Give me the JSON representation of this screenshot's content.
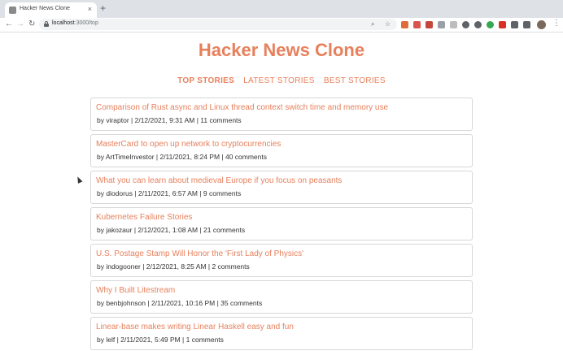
{
  "browser": {
    "tab_title": "Hacker News Clone",
    "tab_close": "×",
    "new_tab": "+",
    "url_host": "localhost",
    "url_path": ":3000/top",
    "back": "←",
    "forward": "→",
    "reload": "↻",
    "menu": "⋮"
  },
  "site": {
    "title": "Hacker News Clone"
  },
  "nav": {
    "items": [
      "TOP STORIES",
      "LATEST STORIES",
      "BEST STORIES"
    ],
    "active": "TOP STORIES"
  },
  "stories": [
    {
      "title": "Comparison of Rust async and Linux thread context switch time and memory use",
      "meta": "by viraptor | 2/12/2021, 9:31 AM | 11 comments"
    },
    {
      "title": "MasterCard to open up network to cryptocurrencies",
      "meta": "by ArtTimeInvestor | 2/11/2021, 8:24 PM | 40 comments"
    },
    {
      "title": "What you can learn about medieval Europe if you focus on peasants",
      "meta": "by diodorus | 2/11/2021, 6:57 AM | 9 comments"
    },
    {
      "title": "Kubernetes Failure Stories",
      "meta": "by jakozaur | 2/12/2021, 1:08 AM | 21 comments"
    },
    {
      "title": "U.S. Postage Stamp Will Honor the 'First Lady of Physics'",
      "meta": "by indogooner | 2/12/2021, 8:25 AM | 2 comments"
    },
    {
      "title": "Why I Built Litestream",
      "meta": "by benbjohnson | 2/11/2021, 10:16 PM | 35 comments"
    },
    {
      "title": "Linear-base makes writing Linear Haskell easy and fun",
      "meta": "by lelf | 2/11/2021, 5:49 PM | 1 comments"
    }
  ],
  "colors": {
    "accent": "#e7805c",
    "meta_text": "#333333",
    "card_border": "#d7d7d7"
  }
}
